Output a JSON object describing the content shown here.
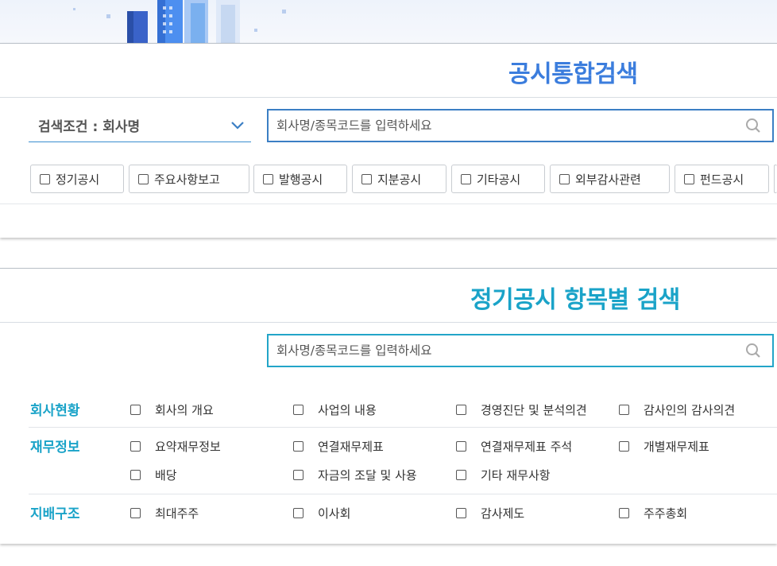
{
  "integrated_search": {
    "title": "공시통합검색",
    "condition_label": "검색조건 : 회사명",
    "search_placeholder": "회사명/종목코드를 입력하세요",
    "filters": [
      {
        "label": "정기공시"
      },
      {
        "label": "주요사항보고"
      },
      {
        "label": "발행공시"
      },
      {
        "label": "지분공시"
      },
      {
        "label": "기타공시"
      },
      {
        "label": "외부감사관련"
      },
      {
        "label": "펀드공시"
      }
    ]
  },
  "item_search": {
    "title": "정기공시 항목별 검색",
    "search_placeholder": "회사명/종목코드를 입력하세요",
    "sections": [
      {
        "label": "회사현황",
        "items": [
          "회사의 개요",
          "사업의 내용",
          "경영진단 및 분석의견",
          "감사인의 감사의견"
        ]
      },
      {
        "label": "재무정보",
        "items": [
          "요약재무정보",
          "연결재무제표",
          "연결재무제표 주석",
          "개별재무제표",
          "배당",
          "자금의 조달 및 사용",
          "기타 재무사항"
        ]
      },
      {
        "label": "지배구조",
        "items": [
          "최대주주",
          "이사회",
          "감사제도",
          "주주총회"
        ]
      }
    ]
  },
  "colors": {
    "title_blue": "#3b7ddd",
    "title_teal": "#1aa3c8",
    "search_border_1": "#3b7fc4",
    "search_border_2": "#23a5c8"
  },
  "icons": {
    "search": "search-icon",
    "dropdown": "chevron-down-icon",
    "checkbox": "checkbox-icon"
  }
}
